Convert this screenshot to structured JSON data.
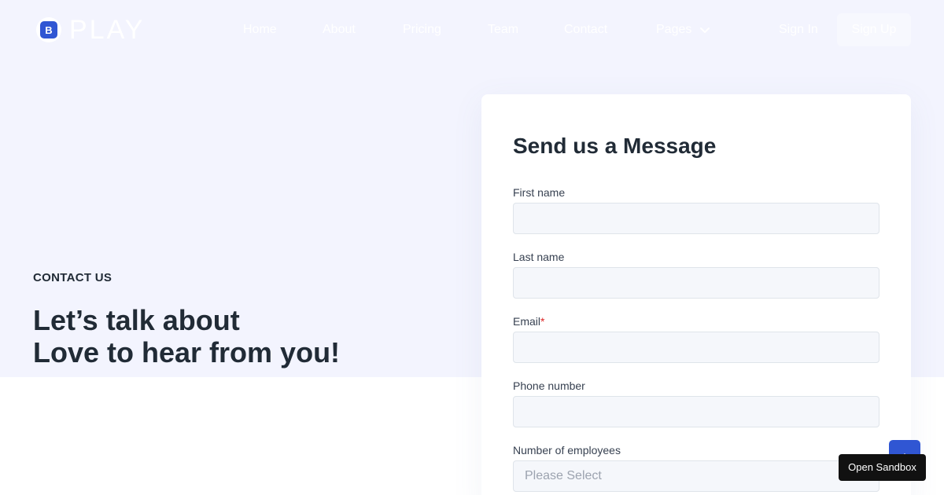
{
  "header": {
    "logo_badge_letter": "B",
    "logo_text": "PLAY",
    "nav": [
      "Home",
      "About",
      "Pricing",
      "Team",
      "Contact"
    ],
    "nav_pages": "Pages",
    "sign_in": "Sign In",
    "sign_up": "Sign Up"
  },
  "hero": {
    "eyebrow": "CONTACT US",
    "headline_line1": "Let’s talk about",
    "headline_line2": "Love to hear from you!"
  },
  "form": {
    "title": "Send us a Message",
    "first_name_label": "First name",
    "last_name_label": "Last name",
    "email_label": "Email",
    "email_required_mark": "*",
    "phone_label": "Phone number",
    "employees_label": "Number of employees",
    "employees_selected": "Please Select"
  },
  "floating": {
    "sandbox_label": "Open Sandbox"
  },
  "colors": {
    "primary": "#3056d3",
    "hero_bg": "#f3f4fe",
    "heading": "#212b36",
    "input_bg": "#f5f7fb"
  },
  "icons": {
    "nav_pages_dropdown": "chevron-down-icon",
    "scroll_top": "arrow-up-icon"
  }
}
